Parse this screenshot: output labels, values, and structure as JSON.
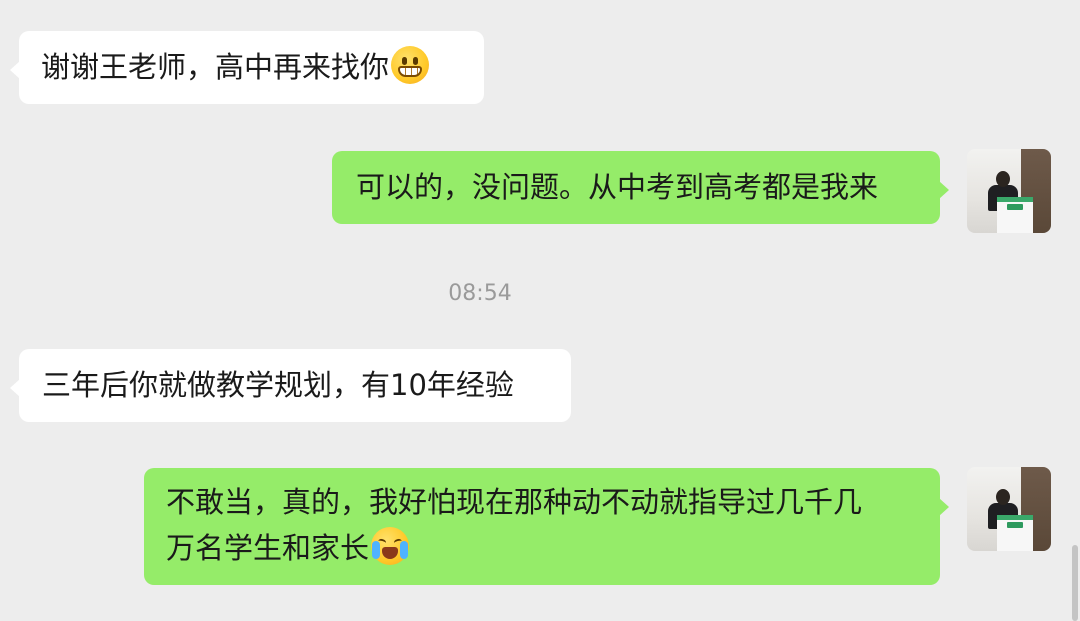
{
  "messages": [
    {
      "side": "left",
      "text": "谢谢王老师，高中再来找你",
      "emoji": "grin-icon"
    },
    {
      "side": "right",
      "text": "可以的，没问题。从中考到高考都是我来"
    },
    {
      "side": "left",
      "text": "三年后你就做教学规划，有10年经验"
    },
    {
      "side": "right",
      "line1": "不敢当，真的，我好怕现在那种动不动就指导过几千几",
      "line2": "万名学生和家长",
      "emoji": "crying-laughing-icon"
    }
  ],
  "timestamp": "08:54",
  "colors": {
    "background": "#ededed",
    "bubble_left": "#ffffff",
    "bubble_right": "#95ec69",
    "timestamp": "#9a9a9a"
  }
}
